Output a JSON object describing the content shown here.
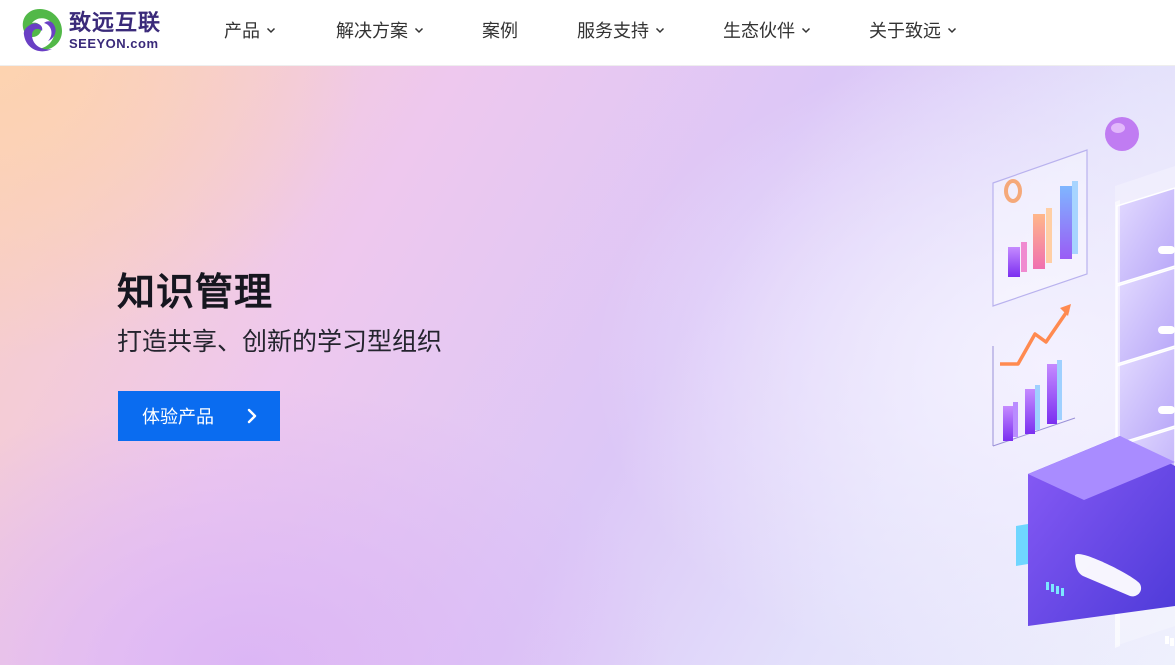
{
  "brand": {
    "name_cn": "致远互联",
    "name_en": "SEEYON.com",
    "colors": {
      "primary": "#3a2a7a",
      "green": "#52b848",
      "purple": "#6a3fc4"
    }
  },
  "nav": {
    "items": [
      {
        "label": "产品",
        "has_dropdown": true
      },
      {
        "label": "解决方案",
        "has_dropdown": true
      },
      {
        "label": "案例",
        "has_dropdown": false
      },
      {
        "label": "服务支持",
        "has_dropdown": true
      },
      {
        "label": "生态伙伴",
        "has_dropdown": true
      },
      {
        "label": "关于致远",
        "has_dropdown": true
      }
    ]
  },
  "hero": {
    "title": "知识管理",
    "subtitle": "打造共享、创新的学习型组织",
    "cta_label": "体验产品",
    "cta_icon": "chevron-right-icon",
    "illustration": "data-charts-server-illustration",
    "colors": {
      "cta": "#0a6cf0",
      "title": "#16161f"
    }
  }
}
